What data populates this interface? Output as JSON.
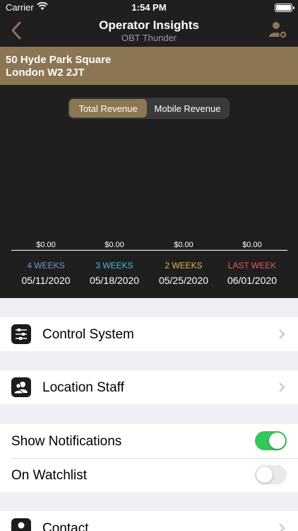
{
  "status_bar": {
    "carrier": "Carrier",
    "time": "1:54 PM"
  },
  "nav": {
    "title": "Operator Insights",
    "subtitle": "OBT Thunder"
  },
  "address": {
    "line1": "50 Hyde Park Square",
    "line2": "London W2 2JT"
  },
  "segments": [
    {
      "label": "Total Revenue",
      "selected": true
    },
    {
      "label": "Mobile Revenue",
      "selected": false
    }
  ],
  "revenue": [
    {
      "value": "$0.00",
      "period": "4 WEEKS",
      "date": "05/11/2020",
      "color": "#6f97d6"
    },
    {
      "value": "$0.00",
      "period": "3 WEEKS",
      "date": "05/18/2020",
      "color": "#3ac1e6"
    },
    {
      "value": "$0.00",
      "period": "2 WEEKS",
      "date": "05/25/2020",
      "color": "#e9b64a"
    },
    {
      "value": "$0.00",
      "period": "LAST WEEK",
      "date": "06/01/2020",
      "color": "#e65a5a"
    }
  ],
  "menu": {
    "control_system": "Control System",
    "location_staff": "Location Staff",
    "show_notifications": "Show Notifications",
    "show_notifications_on": true,
    "on_watchlist": "On Watchlist",
    "on_watchlist_on": false,
    "contact": "Contact"
  },
  "colors": {
    "accent": "#8c7653",
    "toggle_on": "#34c759",
    "dark_bg": "#1f1f1f"
  }
}
